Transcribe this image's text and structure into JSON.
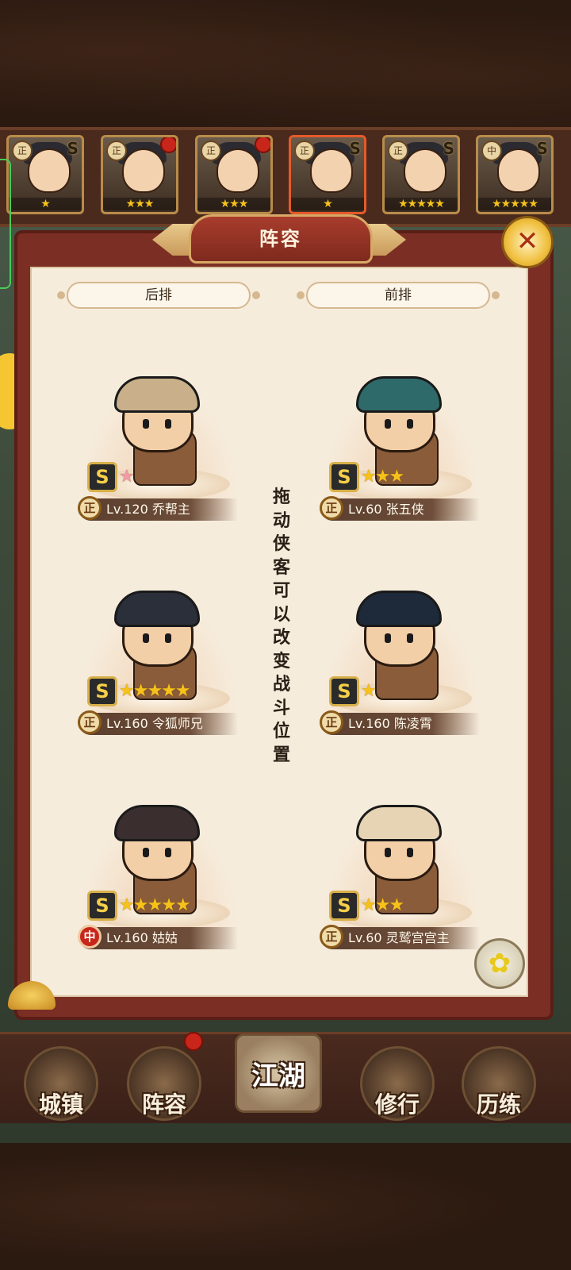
{
  "hero_strip": [
    {
      "rank": "正",
      "badge": "S",
      "stars": "★",
      "alert": false,
      "selected": false
    },
    {
      "rank": "正",
      "badge": "",
      "stars": "★★★",
      "alert": true,
      "selected": false
    },
    {
      "rank": "正",
      "badge": "",
      "stars": "★★★",
      "alert": true,
      "selected": false
    },
    {
      "rank": "正",
      "badge": "S",
      "stars": "★",
      "alert": false,
      "selected": true
    },
    {
      "rank": "正",
      "badge": "S",
      "stars": "★★★★★",
      "alert": false,
      "selected": false
    },
    {
      "rank": "中",
      "badge": "S",
      "stars": "★★★★★",
      "alert": false,
      "selected": false
    }
  ],
  "dialog": {
    "title": "阵容",
    "close_icon": "close-x-icon",
    "back_row_label": "后排",
    "front_row_label": "前排",
    "drag_tip": "拖动侠客可以改变战斗位置"
  },
  "lineup": {
    "back": [
      {
        "faction": "正",
        "faction_color": "gold",
        "rank": "S",
        "stars": "★",
        "star_color": "pink",
        "name": "Lv.120 乔帮主",
        "hair_color": "#c9b08a"
      },
      {
        "faction": "正",
        "faction_color": "gold",
        "rank": "S",
        "stars": "★★★★★",
        "star_color": "gold",
        "name": "Lv.160 令狐师兄",
        "hair_color": "#2b2f3a"
      },
      {
        "faction": "中",
        "faction_color": "red",
        "rank": "S",
        "stars": "★★★★★",
        "star_color": "gold",
        "name": "Lv.160 姑姑",
        "hair_color": "#3a2e2e"
      }
    ],
    "front": [
      {
        "faction": "正",
        "faction_color": "gold",
        "rank": "S",
        "stars": "★★★",
        "star_color": "gold",
        "name": "Lv.60 张五侠",
        "hair_color": "#2f6a6a"
      },
      {
        "faction": "正",
        "faction_color": "gold",
        "rank": "S",
        "stars": "★",
        "star_color": "gold",
        "name": "Lv.160 陈凌霄",
        "hair_color": "#1e2a3a"
      },
      {
        "faction": "正",
        "faction_color": "gold",
        "rank": "S",
        "stars": "★★★",
        "star_color": "gold",
        "name": "Lv.60 灵鹫宫宫主",
        "hair_color": "#e6d4b4"
      }
    ]
  },
  "nav": {
    "town": "城镇",
    "lineup": "阵容",
    "jianghu": "江湖",
    "cultivate": "修行",
    "training": "历练"
  },
  "colors": {
    "accent_gold": "#f5c632",
    "panel": "#f6ecdc",
    "frame": "#7a2e24",
    "star": "#f6c21a",
    "alert": "#c8261a"
  }
}
